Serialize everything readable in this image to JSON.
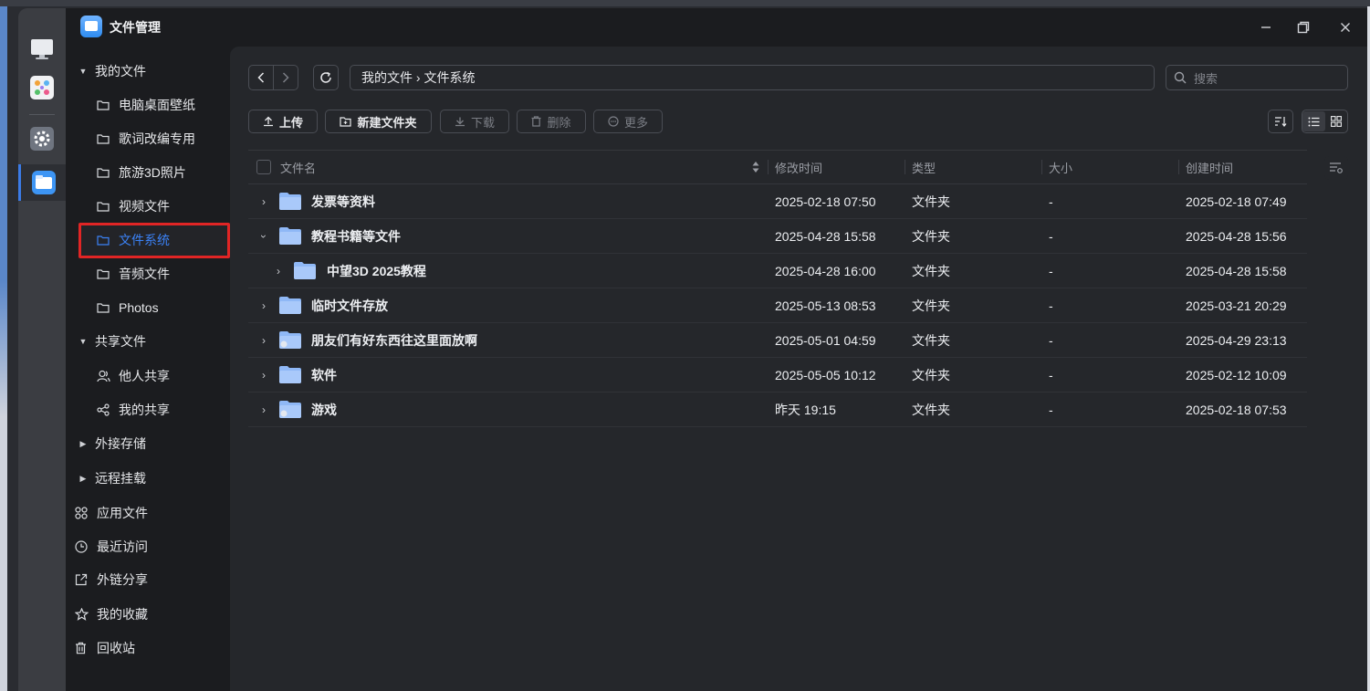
{
  "window": {
    "title": "文件管理",
    "minimize": "—",
    "maximize": "☐",
    "close": "✕"
  },
  "sidebar": {
    "my_files": "我的文件",
    "folders": [
      "电脑桌面壁纸",
      "歌词改编专用",
      "旅游3D照片",
      "视频文件",
      "文件系统",
      "音频文件",
      "Photos"
    ],
    "shared": "共享文件",
    "shared_items": [
      "他人共享",
      "我的共享"
    ],
    "external": "外接存储",
    "remote": "远程挂载",
    "app_files": "应用文件",
    "recent": "最近访问",
    "links": "外链分享",
    "favorites": "我的收藏",
    "trash": "回收站"
  },
  "toolbar": {
    "breadcrumb": "我的文件 › 文件系统",
    "search_placeholder": "搜索",
    "upload": "上传",
    "new_folder": "新建文件夹",
    "download": "下载",
    "delete": "删除",
    "more": "更多"
  },
  "table": {
    "headers": {
      "name": "文件名",
      "modified": "修改时间",
      "type": "类型",
      "size": "大小",
      "created": "创建时间"
    },
    "rows": [
      {
        "name": "发票等资料",
        "modified": "2025-02-18 07:50",
        "type": "文件夹",
        "size": "-",
        "created": "2025-02-18 07:49"
      },
      {
        "name": "教程书籍等文件",
        "modified": "2025-04-28 15:58",
        "type": "文件夹",
        "size": "-",
        "created": "2025-04-28 15:56"
      },
      {
        "name": "中望3D 2025教程",
        "modified": "2025-04-28 16:00",
        "type": "文件夹",
        "size": "-",
        "created": "2025-04-28 15:58"
      },
      {
        "name": "临时文件存放",
        "modified": "2025-05-13 08:53",
        "type": "文件夹",
        "size": "-",
        "created": "2025-03-21 20:29"
      },
      {
        "name": "朋友们有好东西往这里面放啊",
        "modified": "2025-05-01 04:59",
        "type": "文件夹",
        "size": "-",
        "created": "2025-04-29 23:13"
      },
      {
        "name": "软件",
        "modified": "2025-05-05 10:12",
        "type": "文件夹",
        "size": "-",
        "created": "2025-02-12 10:09"
      },
      {
        "name": "游戏",
        "modified": "昨天 19:15",
        "type": "文件夹",
        "size": "-",
        "created": "2025-02-18 07:53"
      }
    ]
  },
  "colors": {
    "accent": "#3b82f6",
    "highlight_box": "#e12525",
    "folder": "#8fb8f6"
  }
}
